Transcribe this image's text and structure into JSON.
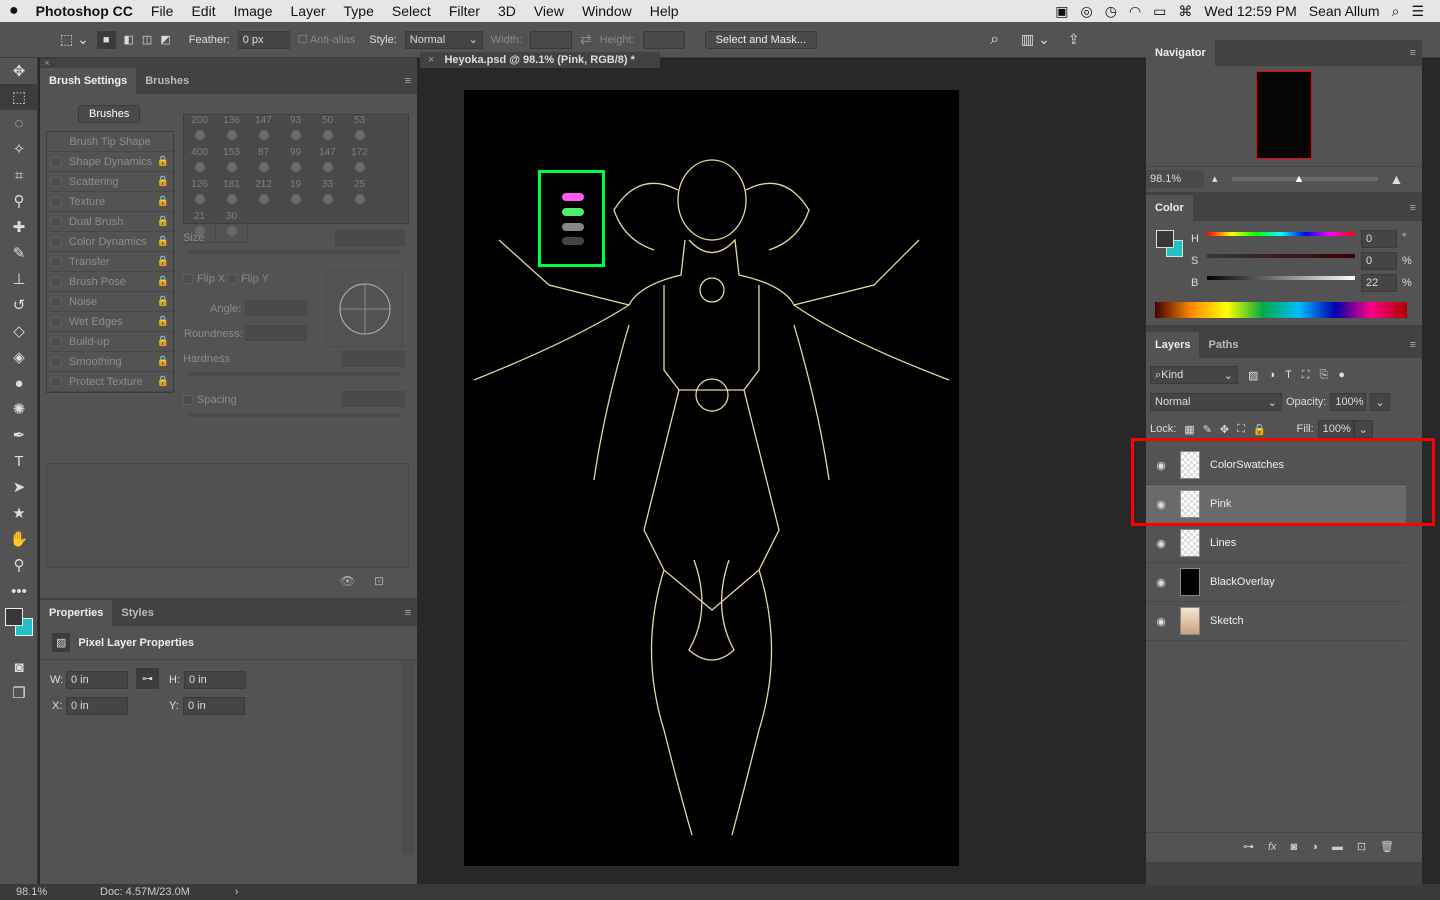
{
  "menubar": {
    "app": "Photoshop CC",
    "items": [
      "File",
      "Edit",
      "Image",
      "Layer",
      "Type",
      "Select",
      "Filter",
      "3D",
      "View",
      "Window",
      "Help"
    ],
    "clock": "Wed 12:59 PM",
    "user": "Sean Allum"
  },
  "options": {
    "feather_label": "Feather:",
    "feather_value": "0 px",
    "antialias": "Anti-alias",
    "style_label": "Style:",
    "style_value": "Normal",
    "width_label": "Width:",
    "height_label": "Height:",
    "select_mask": "Select and Mask..."
  },
  "document": {
    "tab_title": "Heyoka.psd @ 98.1% (Pink, RGB/8) *"
  },
  "brush_panel": {
    "tabs": [
      "Brush Settings",
      "Brushes"
    ],
    "brushes_button": "Brushes",
    "tip_shape": "Brush Tip Shape",
    "options": [
      "Shape Dynamics",
      "Scattering",
      "Texture",
      "Dual Brush",
      "Color Dynamics",
      "Transfer",
      "Brush Pose",
      "Noise",
      "Wet Edges",
      "Build-up",
      "Smoothing",
      "Protect Texture"
    ],
    "tip_sizes": [
      "200",
      "136",
      "147",
      "93",
      "50",
      "53",
      "400",
      "153",
      "87",
      "99",
      "147",
      "172",
      "126",
      "181",
      "212",
      "19",
      "33",
      "25",
      "21",
      "30"
    ],
    "size": "Size",
    "flip_x": "Flip X",
    "flip_y": "Flip Y",
    "angle": "Angle:",
    "roundness": "Roundness:",
    "hardness": "Hardness",
    "spacing": "Spacing"
  },
  "properties": {
    "tabs": [
      "Properties",
      "Styles"
    ],
    "title": "Pixel Layer Properties",
    "w_label": "W:",
    "w": "0 in",
    "h_label": "H:",
    "h": "0 in",
    "x_label": "X:",
    "x": "0 in",
    "y_label": "Y:",
    "y": "0 in"
  },
  "status": {
    "zoom": "98.1%",
    "doc": "Doc: 4.57M/23.0M"
  },
  "navigator": {
    "title": "Navigator",
    "zoom": "98.1%"
  },
  "color": {
    "title": "Color",
    "h_label": "H",
    "s_label": "S",
    "b_label": "B",
    "h": "0",
    "s": "0",
    "b": "22",
    "deg": "°",
    "pct": "%",
    "foreground": "#383838",
    "background": "#22c0c4"
  },
  "layers": {
    "tabs": [
      "Layers",
      "Paths"
    ],
    "filter": "Kind",
    "blend": "Normal",
    "opacity_label": "Opacity:",
    "opacity": "100%",
    "lock_label": "Lock:",
    "fill_label": "Fill:",
    "fill": "100%",
    "items": [
      {
        "name": "ColorSwatches",
        "visible": true
      },
      {
        "name": "Pink",
        "visible": true,
        "selected": true
      },
      {
        "name": "Lines",
        "visible": true
      },
      {
        "name": "BlackOverlay",
        "visible": true
      },
      {
        "name": "Sketch",
        "visible": true
      }
    ]
  },
  "colors": {
    "highlight": "#ff0000",
    "swatch_box": "#00ff44",
    "line_art": "#e8d8a0",
    "swatch_pink": "#ff5cf0",
    "swatch_green": "#4cf070"
  }
}
